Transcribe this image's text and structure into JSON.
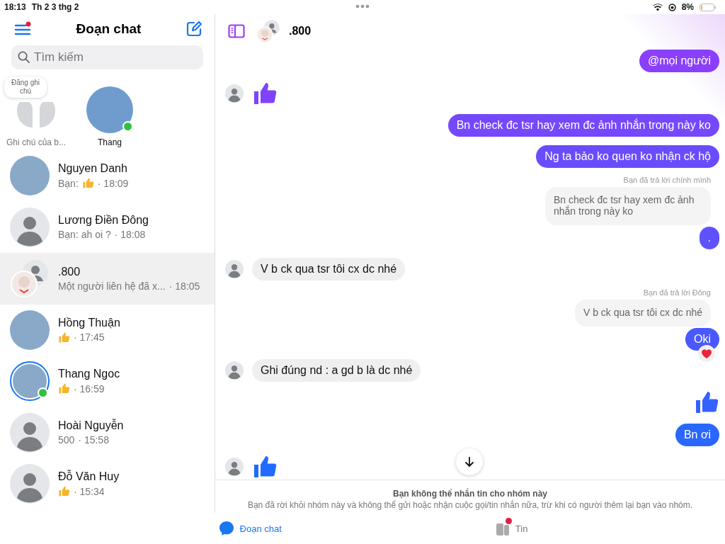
{
  "status_bar": {
    "time": "18:13",
    "date": "Th 2 3 thg 2",
    "battery": "8%"
  },
  "sidebar": {
    "title": "Đoạn chat",
    "menu_notification": true,
    "search": {
      "placeholder": "Tìm kiếm"
    },
    "notes": [
      {
        "kind": "own",
        "bubble": "Đăng ghi chú",
        "label": "Ghi chú của b...",
        "online": false
      },
      {
        "kind": "photo",
        "label": "Thang",
        "online": true
      }
    ],
    "conversations": [
      {
        "name": "Nguyen Danh",
        "kind": "photo",
        "preview": "Bạn:",
        "like": true,
        "time": "· 18:09",
        "selected": false,
        "online": false,
        "story": false
      },
      {
        "name": "Lương Điền Đông",
        "kind": "default",
        "preview": "Bạn: ah oi ?",
        "like": false,
        "time": "· 18:08",
        "selected": false,
        "online": false,
        "story": false
      },
      {
        "name": ".800",
        "kind": "group",
        "preview": "Một người liên hệ đã x...",
        "like": false,
        "time": "· 18:05",
        "selected": true,
        "online": false,
        "story": false
      },
      {
        "name": "Hồng Thuận",
        "kind": "photo",
        "like": true,
        "time": "· 17:45",
        "selected": false,
        "online": false,
        "story": false
      },
      {
        "name": "Thang Ngoc",
        "kind": "photo",
        "like": true,
        "time": "· 16:59",
        "selected": false,
        "online": true,
        "story": true
      },
      {
        "name": "Hoài Nguyễn",
        "kind": "default",
        "preview": "500",
        "like": false,
        "time": "· 15:58",
        "selected": false,
        "online": false,
        "story": false
      },
      {
        "name": "Đỗ Văn Huy",
        "kind": "default",
        "like": true,
        "time": "· 15:34",
        "selected": false,
        "online": false,
        "story": false
      }
    ]
  },
  "chat": {
    "title": ".800",
    "messages": [
      {
        "kind": "text",
        "outgoing": true,
        "text": "@mọi người"
      },
      {
        "kind": "like",
        "outgoing": false
      },
      {
        "kind": "text",
        "outgoing": true,
        "text": "Bn check đc tsr hay xem đc ảnh nhắn trong này ko"
      },
      {
        "kind": "text",
        "outgoing": true,
        "text": "Ng ta bảo ko quen ko nhận ck hộ"
      },
      {
        "kind": "reply",
        "outgoing": true,
        "label": "Bạn đã trả lời chính mình",
        "quote": "Bn check đc tsr hay xem đc ảnh nhắn trong này ko",
        "text": ".",
        "heart": false
      },
      {
        "kind": "text",
        "outgoing": false,
        "text": "V b ck qua tsr tôi cx dc nhé"
      },
      {
        "kind": "reply",
        "outgoing": true,
        "label": "Bạn đã trả lời Đông",
        "quote": "V b ck qua tsr tôi cx dc nhé",
        "text": "Oki",
        "heart": true
      },
      {
        "kind": "text",
        "outgoing": false,
        "text": "Ghi đúng nd : a gd b là dc nhé"
      },
      {
        "kind": "like",
        "outgoing": true
      },
      {
        "kind": "text",
        "outgoing": true,
        "text": "Bn ơi"
      },
      {
        "kind": "like",
        "outgoing": false
      }
    ],
    "notice": {
      "title": "Bạn không thể nhắn tin cho nhóm này",
      "body": "Bạn đã rời khỏi nhóm này và không thể gửi hoặc nhận cuộc gọi/tin nhắn nữa, trừ khi có người thêm lại bạn vào nhóm."
    }
  },
  "tab_bar": [
    {
      "kind": "chats",
      "label": "Đoạn chat",
      "selected": true,
      "badge": false
    },
    {
      "kind": "stories",
      "label": "Tin",
      "selected": false,
      "badge": true
    }
  ]
}
